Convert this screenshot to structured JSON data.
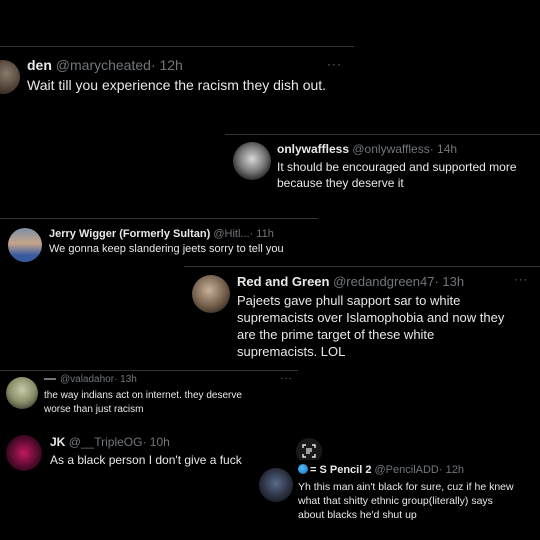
{
  "tweets": [
    {
      "name": "den",
      "handle": "@marycheated",
      "time": "· 12h",
      "text": [
        "Wait till you experience the racism they dish out."
      ],
      "more": "···"
    },
    {
      "name": "onlywaffless",
      "handle": "@onlywaffless",
      "time": "· 14h",
      "text": [
        "It should be encouraged and supported more",
        "because they deserve it"
      ],
      "more": "···"
    },
    {
      "name": "Jerry Wigger (Formerly Sultan)",
      "handle": "@Hitl...",
      "time": "· 11h",
      "text": [
        "We gonna keep slandering jeets sorry to tell you"
      ],
      "more": "···"
    },
    {
      "name": "Red and Green",
      "handle": "@redandgreen47",
      "time": "· 13h",
      "text": [
        "Pajeets gave phull sapport sar to white",
        "supremacists over Islamophobia and now they",
        "are the prime target of these white",
        "supremacists. LOL"
      ],
      "more": "···"
    },
    {
      "name": "",
      "handle": "@valadahor",
      "time": "· 13h",
      "text": [
        "the way indians act on internet. they deserve",
        "worse than just racism"
      ],
      "more": "···"
    },
    {
      "name": "JK",
      "handle": "@__TripleOG",
      "time": "· 10h",
      "text": [
        "As a black person I don't give a fuck"
      ],
      "more": "···"
    },
    {
      "name": "= S Pencil 2",
      "handle": "@PencilADD",
      "time": "· 12h",
      "text": [
        "Yh this man ain't black for sure, cuz if he knew",
        "what that shitty ethnic group(literally) says",
        "about blacks he'd shut up"
      ],
      "more": "···"
    }
  ],
  "colors": {
    "background": "#000000",
    "text": "#e7e9ea",
    "secondary": "#71767b",
    "divider": "#2f3336"
  }
}
